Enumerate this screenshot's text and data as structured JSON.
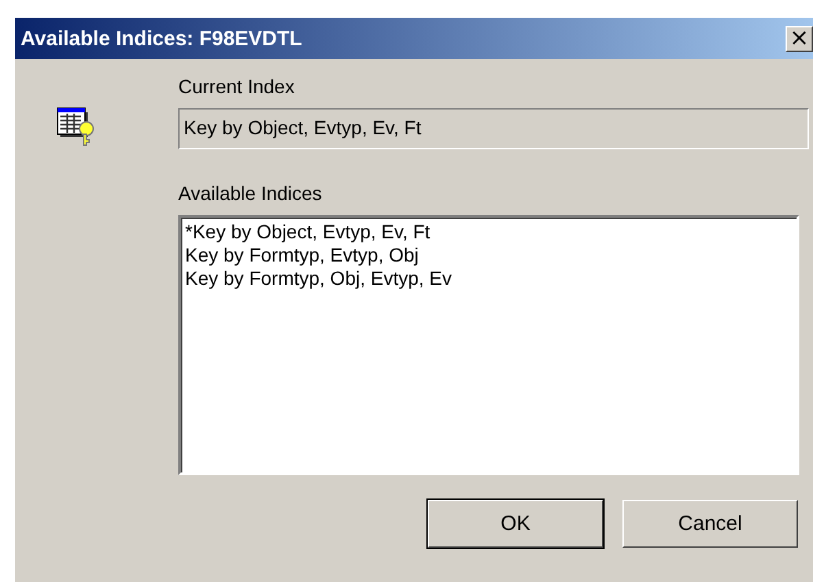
{
  "window": {
    "title": "Available Indices: F98EVDTL",
    "close_label": "×"
  },
  "current_index": {
    "label": "Current Index",
    "value": "Key by Object, Evtyp, Ev, Ft"
  },
  "available_indices": {
    "label": "Available Indices",
    "items": [
      {
        "text": "*Key by Object, Evtyp, Ev, Ft"
      },
      {
        "text": "Key by Formtyp, Evtyp, Obj"
      },
      {
        "text": "Key by Formtyp, Obj, Evtyp, Ev"
      }
    ]
  },
  "buttons": [
    {
      "label": "OK",
      "default": true
    },
    {
      "label": "Cancel",
      "default": false
    }
  ]
}
